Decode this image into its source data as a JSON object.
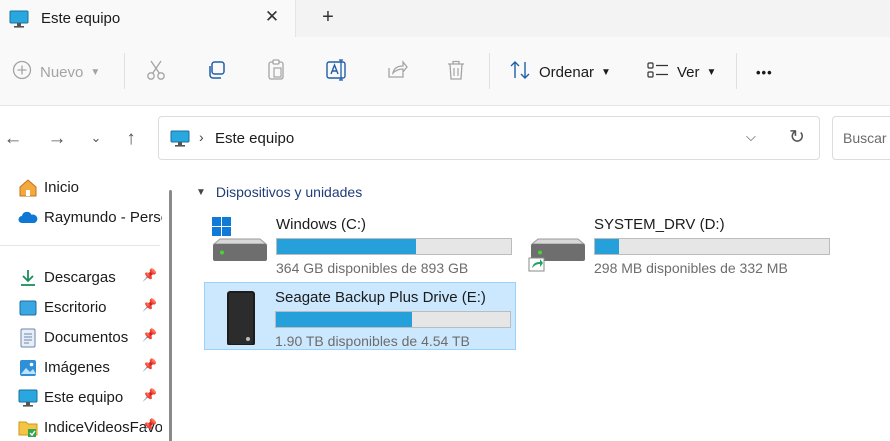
{
  "tab": {
    "title": "Este equipo",
    "close_glyph": "✕",
    "new_glyph": "+"
  },
  "toolbar": {
    "new_label": "Nuevo",
    "sort_label": "Ordenar",
    "view_label": "Ver",
    "more_glyph": "•••"
  },
  "address": {
    "path": "Este equipo",
    "search_placeholder": "Buscar en Este equipo"
  },
  "sidebar": {
    "items": [
      {
        "label": "Inicio",
        "icon": "home-icon",
        "pinned": false
      },
      {
        "label": "Raymundo - Personal",
        "icon": "onedrive-icon",
        "pinned": false
      },
      {
        "label": "Descargas",
        "icon": "download-icon",
        "pinned": true
      },
      {
        "label": "Escritorio",
        "icon": "desktop-icon",
        "pinned": true
      },
      {
        "label": "Documentos",
        "icon": "documents-icon",
        "pinned": true
      },
      {
        "label": "Imágenes",
        "icon": "pictures-icon",
        "pinned": true
      },
      {
        "label": "Este equipo",
        "icon": "this-pc-icon",
        "pinned": true
      },
      {
        "label": "IndiceVideosFavoritos",
        "icon": "folder-icon",
        "pinned": true
      }
    ]
  },
  "main": {
    "group_title": "Dispositivos y unidades",
    "drives": [
      {
        "name": "Windows (C:)",
        "free_text": "364 GB disponibles de 893 GB",
        "used_fraction": 0.592,
        "icon": "windows-drive-icon",
        "selected": false
      },
      {
        "name": "SYSTEM_DRV (D:)",
        "free_text": "298 MB disponibles de 332 MB",
        "used_fraction": 0.102,
        "icon": "shared-drive-icon",
        "selected": false
      },
      {
        "name": "Seagate Backup Plus Drive (E:)",
        "free_text": "1.90 TB disponibles de 4.54 TB",
        "used_fraction": 0.581,
        "icon": "external-hdd-icon",
        "selected": true
      }
    ]
  },
  "colors": {
    "accent": "#26a0da",
    "selection": "#cce8ff",
    "group_header": "#1f3d7a"
  }
}
